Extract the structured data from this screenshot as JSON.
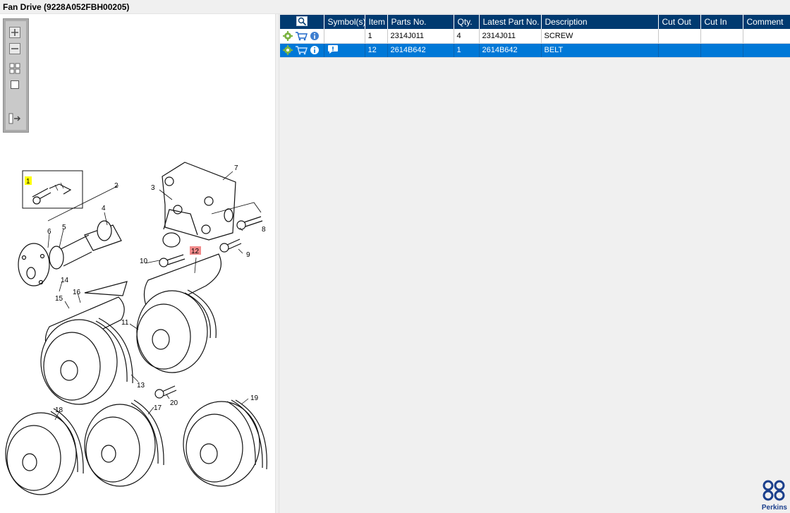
{
  "window": {
    "title": "Fan Drive (9228A052FBH00205)"
  },
  "toolbar": {
    "zoom_in": "zoom-in-icon",
    "zoom_out": "zoom-out-icon",
    "fit_all": "fit-all-icon",
    "actual_size": "actual-size-icon",
    "toggle_list": "toggle-list-icon"
  },
  "drawing": {
    "callouts": [
      "1",
      "2",
      "3",
      "4",
      "5",
      "6",
      "7",
      "8",
      "9",
      "10",
      "11",
      "12",
      "13",
      "14",
      "15",
      "16",
      "17",
      "18",
      "19",
      "20"
    ],
    "highlight_yellow": "1",
    "highlight_red": "12"
  },
  "table": {
    "columns": [
      "",
      "Symbol(s)",
      "Item",
      "Parts No.",
      "Qty.",
      "Latest Part No.",
      "Description",
      "Cut Out",
      "Cut In",
      "Comment"
    ],
    "rows": [
      {
        "item": "1",
        "parts_no": "2314J011",
        "qty": "4",
        "latest": "2314J011",
        "description": "SCREW",
        "cut_out": "",
        "cut_in": "",
        "comment": "",
        "selected": false,
        "has_symbol": false
      },
      {
        "item": "12",
        "parts_no": "2614B642",
        "qty": "1",
        "latest": "2614B642",
        "description": "BELT",
        "cut_out": "",
        "cut_in": "",
        "comment": "",
        "selected": true,
        "has_symbol": true
      }
    ]
  },
  "brand": {
    "name": "Perkins",
    "color": "#1b3f8c"
  },
  "colors": {
    "header": "#003a70",
    "selected": "#0078d7",
    "highlight_yellow": "#ffff00",
    "highlight_red": "#f28b8b"
  }
}
